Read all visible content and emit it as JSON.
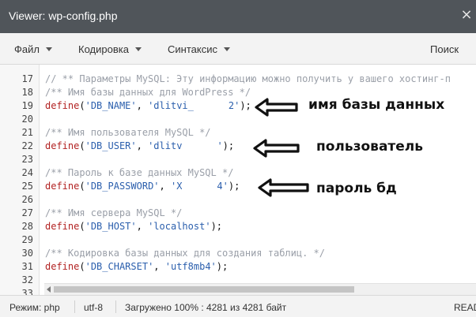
{
  "window": {
    "title": "Viewer: wp-config.php",
    "close_glyph": "×"
  },
  "menu": {
    "file": "Файл",
    "encoding": "Кодировка",
    "syntax": "Синтаксис",
    "search": "Поиск"
  },
  "editor": {
    "lines": [
      {
        "n": "",
        "parts": []
      },
      {
        "n": "17",
        "parts": [
          {
            "t": "// ** Параметры MySQL: Эту информацию можно получить у вашего хостинг-п",
            "c": "cmt"
          }
        ]
      },
      {
        "n": "18",
        "parts": [
          {
            "t": "/** Имя базы данных для WordPress */",
            "c": "cmt"
          }
        ]
      },
      {
        "n": "19",
        "parts": [
          {
            "t": "define",
            "c": "kw"
          },
          {
            "t": "(",
            "c": "pl"
          },
          {
            "t": "'DB_NAME'",
            "c": "str"
          },
          {
            "t": ", ",
            "c": "pl"
          },
          {
            "t": "'dlitvi_",
            "c": "str"
          },
          {
            "t": "",
            "c": "redact"
          },
          {
            "t": "2'",
            "c": "str"
          },
          {
            "t": ");",
            "c": "pl"
          }
        ]
      },
      {
        "n": "20",
        "parts": []
      },
      {
        "n": "21",
        "parts": [
          {
            "t": "/** Имя пользователя MySQL */",
            "c": "cmt"
          }
        ]
      },
      {
        "n": "22",
        "parts": [
          {
            "t": "define",
            "c": "kw"
          },
          {
            "t": "(",
            "c": "pl"
          },
          {
            "t": "'DB_USER'",
            "c": "str"
          },
          {
            "t": ", ",
            "c": "pl"
          },
          {
            "t": "'dlitv",
            "c": "str"
          },
          {
            "t": "",
            "c": "redact"
          },
          {
            "t": "'",
            "c": "str"
          },
          {
            "t": ");",
            "c": "pl"
          }
        ]
      },
      {
        "n": "23",
        "parts": []
      },
      {
        "n": "24",
        "parts": [
          {
            "t": "/** Пароль к базе данных MySQL */",
            "c": "cmt"
          }
        ]
      },
      {
        "n": "25",
        "parts": [
          {
            "t": "define",
            "c": "kw"
          },
          {
            "t": "(",
            "c": "pl"
          },
          {
            "t": "'DB_PASSWORD'",
            "c": "str"
          },
          {
            "t": ", ",
            "c": "pl"
          },
          {
            "t": "'X",
            "c": "str"
          },
          {
            "t": "",
            "c": "redact"
          },
          {
            "t": "4'",
            "c": "str"
          },
          {
            "t": ");",
            "c": "pl"
          }
        ]
      },
      {
        "n": "26",
        "parts": []
      },
      {
        "n": "27",
        "parts": [
          {
            "t": "/** Имя сервера MySQL */",
            "c": "cmt"
          }
        ]
      },
      {
        "n": "28",
        "parts": [
          {
            "t": "define",
            "c": "kw"
          },
          {
            "t": "(",
            "c": "pl"
          },
          {
            "t": "'DB_HOST'",
            "c": "str"
          },
          {
            "t": ", ",
            "c": "pl"
          },
          {
            "t": "'localhost'",
            "c": "str"
          },
          {
            "t": ");",
            "c": "pl"
          }
        ]
      },
      {
        "n": "29",
        "parts": []
      },
      {
        "n": "30",
        "parts": [
          {
            "t": "/** Кодировка базы данных для создания таблиц. */",
            "c": "cmt"
          }
        ]
      },
      {
        "n": "31",
        "parts": [
          {
            "t": "define",
            "c": "kw"
          },
          {
            "t": "(",
            "c": "pl"
          },
          {
            "t": "'DB_CHARSET'",
            "c": "str"
          },
          {
            "t": ", ",
            "c": "pl"
          },
          {
            "t": "'utf8mb4'",
            "c": "str"
          },
          {
            "t": ");",
            "c": "pl"
          }
        ]
      },
      {
        "n": "32",
        "parts": []
      },
      {
        "n": "33",
        "parts": []
      }
    ]
  },
  "annotations": {
    "db_name": "имя базы данных",
    "db_user": "пользователь",
    "db_password": "пароль бд"
  },
  "status": {
    "mode": "Режим: php",
    "encoding": "utf-8",
    "loaded": "Загружено 100% : 4281 из 4281 байт",
    "ready": "READ"
  },
  "icons": {
    "close": "close-icon",
    "annotation_arrow": "arrow-left-icon",
    "scroll_left": "chevron-left-icon"
  },
  "colors": {
    "titlebar": "#50555a",
    "keyword": "#b22222",
    "string": "#2b5fad",
    "comment": "#9a9fa8"
  }
}
